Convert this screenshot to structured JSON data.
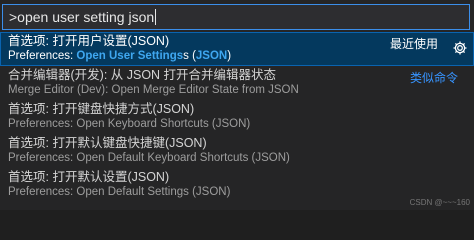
{
  "search": {
    "value": ">open user setting json"
  },
  "items": [
    {
      "title": "首选项: 打开用户设置(JSON)",
      "subtitle_before": "Preferences: ",
      "subtitle_highlight": "Open User Settings",
      "subtitle_middle": "s (",
      "subtitle_highlight2": "JSON",
      "subtitle_after": ")",
      "badge": "最近使用"
    },
    {
      "title": "合并编辑器(开发): 从 JSON 打开合并编辑器状态",
      "subtitle": "Merge Editor (Dev): Open Merge Editor State from JSON",
      "badge": "类似命令"
    },
    {
      "title": "首选项: 打开键盘快捷方式(JSON)",
      "subtitle": "Preferences: Open Keyboard Shortcuts (JSON)"
    },
    {
      "title": "首选项: 打开默认键盘快捷键(JSON)",
      "subtitle": "Preferences: Open Default Keyboard Shortcuts (JSON)"
    },
    {
      "title": "首选项: 打开默认设置(JSON)",
      "subtitle": "Preferences: Open Default Settings (JSON)"
    }
  ],
  "icons": {
    "gear": "gear-icon"
  },
  "colors": {
    "accent": "#3794ff",
    "selection_bg": "#04395e",
    "highlight": "#3fa7f0"
  },
  "watermark": "CSDN @~~~160"
}
